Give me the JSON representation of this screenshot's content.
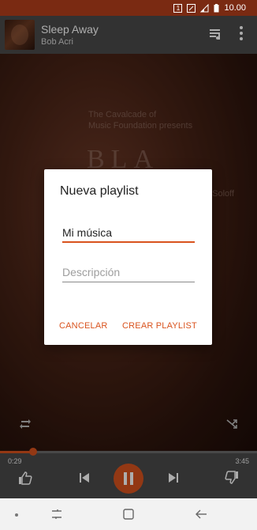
{
  "status_bar": {
    "time": "10.00",
    "sim_badge": "1"
  },
  "now_playing": {
    "title": "Sleep Away",
    "artist": "Bob Acri"
  },
  "album_art": {
    "line1": "The Cavalcade of",
    "line2": "Music Foundation presents",
    "big_text": "BLA",
    "name_fragment": "ew Soloff"
  },
  "player": {
    "elapsed": "0:29",
    "total": "3:45",
    "progress": 0.128
  },
  "dialog": {
    "title": "Nueva playlist",
    "name_value": "Mi música",
    "description_placeholder": "Descripción",
    "cancel_label": "CANCELAR",
    "create_label": "CREAR PLAYLIST"
  },
  "colors": {
    "accent": "#d9531e",
    "status_bar": "#7a2a12",
    "header": "#4a4a4a"
  },
  "icons": [
    "queue-music-icon",
    "more-vert-icon",
    "repeat-icon",
    "shuffle-icon",
    "thumb-up-icon",
    "skip-previous-icon",
    "pause-icon",
    "skip-next-icon",
    "thumb-down-icon",
    "recent-apps-icon",
    "home-icon",
    "back-icon"
  ]
}
